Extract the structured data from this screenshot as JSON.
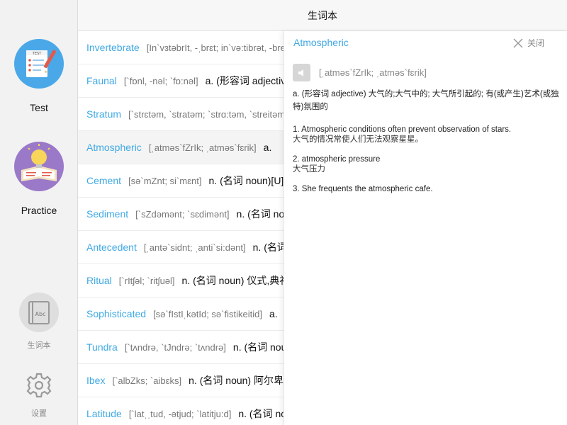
{
  "header": {
    "title": "生词本"
  },
  "sidebar": {
    "test_label": "Test",
    "practice_label": "Practice",
    "vocab_label": "生词本",
    "settings_label": "设置",
    "test_badge": "TEST",
    "vocab_badge": "Abc"
  },
  "words": [
    {
      "word": "Invertebrate",
      "phonetic": "[In`vɜtəbrIt, -ˌbrɛt; in`və:tibrət, -breit]",
      "def": ""
    },
    {
      "word": "Faunal",
      "phonetic": "[`fɒnl, -nəl; `fɒ:nəl]",
      "def": "a. (形容词 adjective)"
    },
    {
      "word": "Stratum",
      "phonetic": "[`strɛtəm, `stratəm; `strɑ:təm, `streitəm]",
      "def": ""
    },
    {
      "word": "Atmospheric",
      "phonetic": "[ˌatməs`fZrIk; ˌatməs`fɛrik]",
      "def": "a."
    },
    {
      "word": "Cement",
      "phonetic": "[sə`mZnt; si`mɛnt]",
      "def": "n. (名词 noun)[U]"
    },
    {
      "word": "Sediment",
      "phonetic": "[`sZdəmənt; `sɛdimənt]",
      "def": "n. (名词 noun)"
    },
    {
      "word": "Antecedent",
      "phonetic": "[ˌantə`sidnt; ˌanti`si:dənt]",
      "def": "n. (名词 noun)"
    },
    {
      "word": "Ritual",
      "phonetic": "[`rItʃəl; `ritʃuəl]",
      "def": "n. (名词 noun) 仪式,典礼"
    },
    {
      "word": "Sophisticated",
      "phonetic": "[sə`fIstIˌkətId; sə`fistikeitid]",
      "def": "a."
    },
    {
      "word": "Tundra",
      "phonetic": "[`tʌndrə, `tJndrə; `tʌndrə]",
      "def": "n. (名词 noun)"
    },
    {
      "word": "Ibex",
      "phonetic": "[`albZks; `aibɛks]",
      "def": "n. (名词 noun) 阿尔卑斯山羊"
    },
    {
      "word": "Latitude",
      "phonetic": "[`latˌˌtud, -ətjud; `latitju:d]",
      "def": "n. (名词 noun)"
    }
  ],
  "detail": {
    "word": "Atmospheric",
    "close_label": "关闭",
    "phonetic": "[ˌatməs`fZrIk; ˌatməs`fɛrik]",
    "definition": "a. (形容词 adjective) 大气的;大气中的; 大气所引起的; 有(或产生)艺术(或独特)氛围的",
    "examples": [
      {
        "en": "1. Atmospheric conditions often prevent observation of stars.",
        "zh": "大气的情况常使人们无法观察星星。"
      },
      {
        "en": "2. atmospheric pressure",
        "zh": "大气压力"
      },
      {
        "en": "3. She frequents the atmospheric cafe.",
        "zh": ""
      }
    ]
  },
  "colors": {
    "accent": "#3fa9e4",
    "test_circle": "#4aa8e8",
    "practice_circle": "#9b79c9"
  }
}
